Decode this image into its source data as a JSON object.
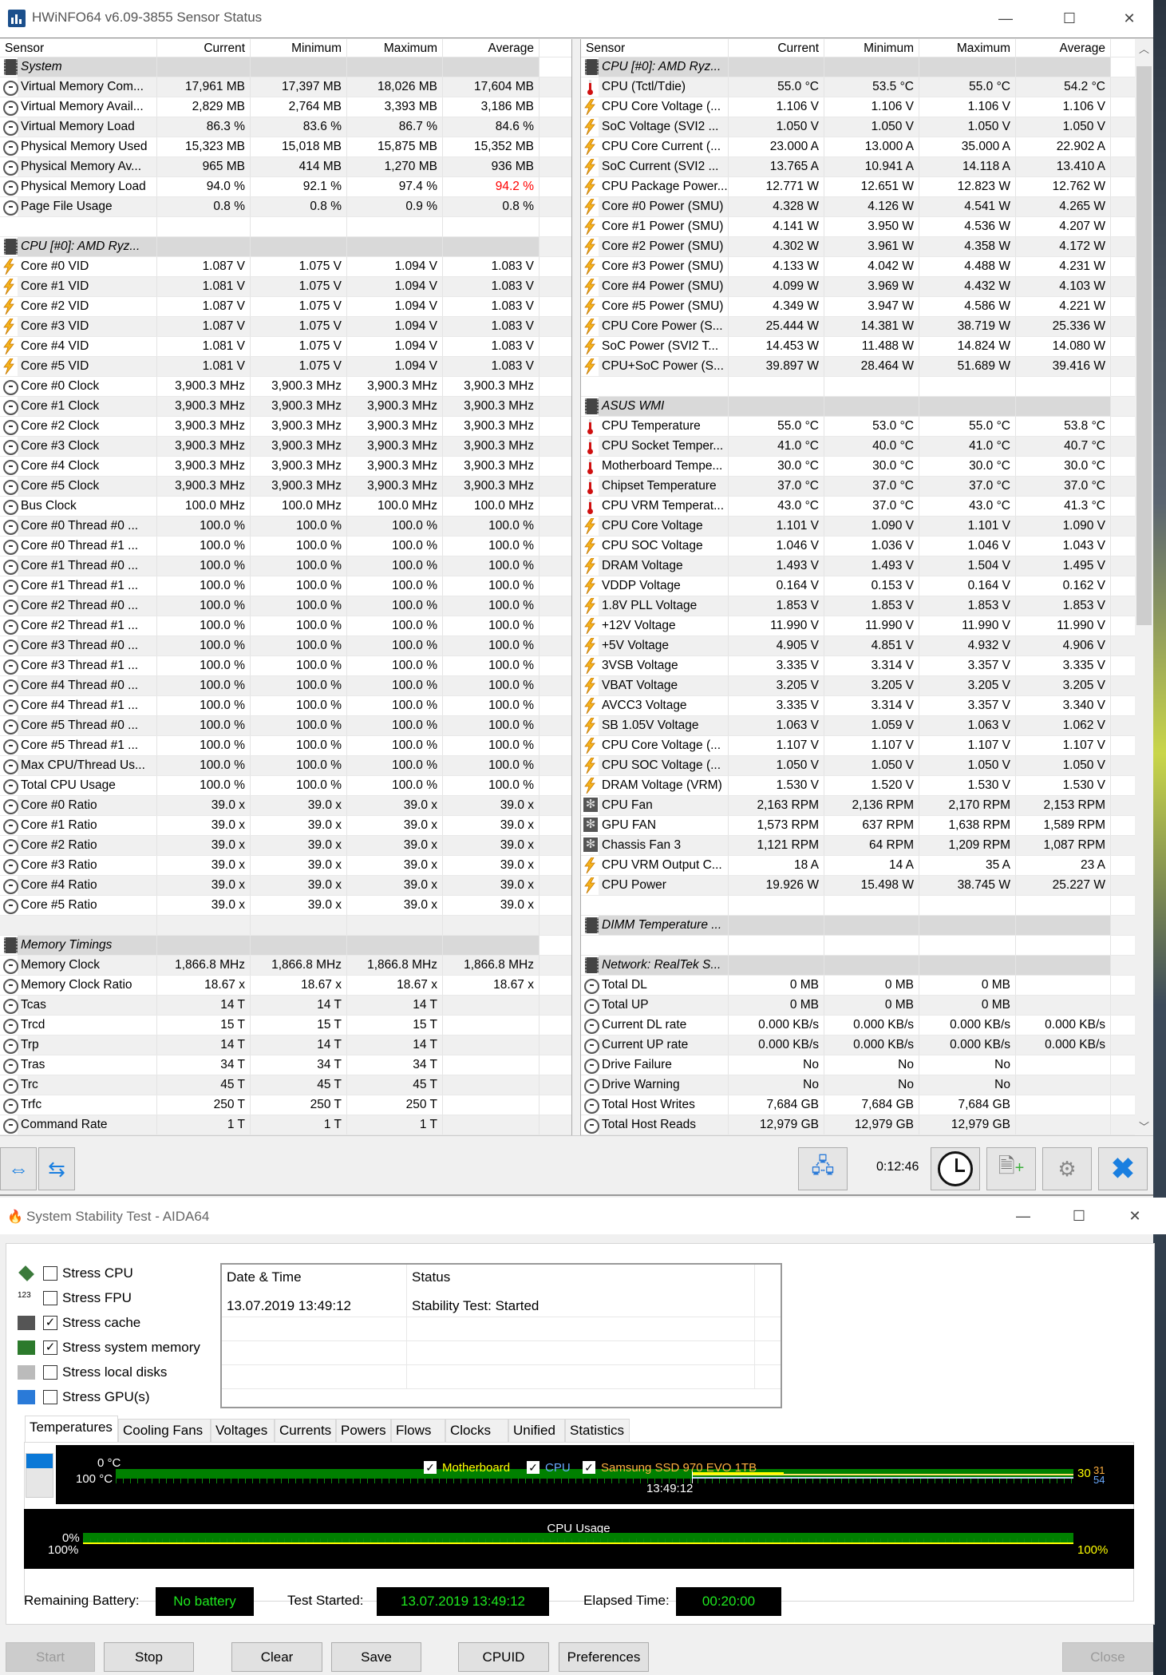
{
  "hwinfo": {
    "title": "HWiNFO64 v6.09-3855 Sensor Status",
    "columns": [
      "Sensor",
      "Current",
      "Minimum",
      "Maximum",
      "Average"
    ],
    "elapsed": "0:12:46",
    "highlight": {
      "panel": "left",
      "row": 6,
      "col": 4,
      "color": "#ff0000"
    },
    "left_rows": [
      [
        "chip",
        "System"
      ],
      [
        "clock",
        "Virtual Memory Com...",
        "17,961 MB",
        "17,397 MB",
        "18,026 MB",
        "17,604 MB"
      ],
      [
        "clock",
        "Virtual Memory Avail...",
        "2,829 MB",
        "2,764 MB",
        "3,393 MB",
        "3,186 MB"
      ],
      [
        "clock",
        "Virtual Memory Load",
        "86.3 %",
        "83.6 %",
        "86.7 %",
        "84.6 %"
      ],
      [
        "clock",
        "Physical Memory Used",
        "15,323 MB",
        "15,018 MB",
        "15,875 MB",
        "15,352 MB"
      ],
      [
        "clock",
        "Physical Memory Av...",
        "965 MB",
        "414 MB",
        "1,270 MB",
        "936 MB"
      ],
      [
        "clock",
        "Physical Memory Load",
        "94.0 %",
        "92.1 %",
        "97.4 %",
        "94.2 %"
      ],
      [
        "clock",
        "Page File Usage",
        "0.8 %",
        "0.8 %",
        "0.9 %",
        "0.8 %"
      ],
      [
        "blank"
      ],
      [
        "chip",
        "CPU [#0]: AMD Ryz..."
      ],
      [
        "bolt",
        "Core #0 VID",
        "1.087 V",
        "1.075 V",
        "1.094 V",
        "1.083 V"
      ],
      [
        "bolt",
        "Core #1 VID",
        "1.081 V",
        "1.075 V",
        "1.094 V",
        "1.083 V"
      ],
      [
        "bolt",
        "Core #2 VID",
        "1.087 V",
        "1.075 V",
        "1.094 V",
        "1.083 V"
      ],
      [
        "bolt",
        "Core #3 VID",
        "1.087 V",
        "1.075 V",
        "1.094 V",
        "1.083 V"
      ],
      [
        "bolt",
        "Core #4 VID",
        "1.081 V",
        "1.075 V",
        "1.094 V",
        "1.083 V"
      ],
      [
        "bolt",
        "Core #5 VID",
        "1.081 V",
        "1.075 V",
        "1.094 V",
        "1.083 V"
      ],
      [
        "clock",
        "Core #0 Clock",
        "3,900.3 MHz",
        "3,900.3 MHz",
        "3,900.3 MHz",
        "3,900.3 MHz"
      ],
      [
        "clock",
        "Core #1 Clock",
        "3,900.3 MHz",
        "3,900.3 MHz",
        "3,900.3 MHz",
        "3,900.3 MHz"
      ],
      [
        "clock",
        "Core #2 Clock",
        "3,900.3 MHz",
        "3,900.3 MHz",
        "3,900.3 MHz",
        "3,900.3 MHz"
      ],
      [
        "clock",
        "Core #3 Clock",
        "3,900.3 MHz",
        "3,900.3 MHz",
        "3,900.3 MHz",
        "3,900.3 MHz"
      ],
      [
        "clock",
        "Core #4 Clock",
        "3,900.3 MHz",
        "3,900.3 MHz",
        "3,900.3 MHz",
        "3,900.3 MHz"
      ],
      [
        "clock",
        "Core #5 Clock",
        "3,900.3 MHz",
        "3,900.3 MHz",
        "3,900.3 MHz",
        "3,900.3 MHz"
      ],
      [
        "clock",
        "Bus Clock",
        "100.0 MHz",
        "100.0 MHz",
        "100.0 MHz",
        "100.0 MHz"
      ],
      [
        "clock",
        "Core #0 Thread #0 ...",
        "100.0 %",
        "100.0 %",
        "100.0 %",
        "100.0 %"
      ],
      [
        "clock",
        "Core #0 Thread #1 ...",
        "100.0 %",
        "100.0 %",
        "100.0 %",
        "100.0 %"
      ],
      [
        "clock",
        "Core #1 Thread #0 ...",
        "100.0 %",
        "100.0 %",
        "100.0 %",
        "100.0 %"
      ],
      [
        "clock",
        "Core #1 Thread #1 ...",
        "100.0 %",
        "100.0 %",
        "100.0 %",
        "100.0 %"
      ],
      [
        "clock",
        "Core #2 Thread #0 ...",
        "100.0 %",
        "100.0 %",
        "100.0 %",
        "100.0 %"
      ],
      [
        "clock",
        "Core #2 Thread #1 ...",
        "100.0 %",
        "100.0 %",
        "100.0 %",
        "100.0 %"
      ],
      [
        "clock",
        "Core #3 Thread #0 ...",
        "100.0 %",
        "100.0 %",
        "100.0 %",
        "100.0 %"
      ],
      [
        "clock",
        "Core #3 Thread #1 ...",
        "100.0 %",
        "100.0 %",
        "100.0 %",
        "100.0 %"
      ],
      [
        "clock",
        "Core #4 Thread #0 ...",
        "100.0 %",
        "100.0 %",
        "100.0 %",
        "100.0 %"
      ],
      [
        "clock",
        "Core #4 Thread #1 ...",
        "100.0 %",
        "100.0 %",
        "100.0 %",
        "100.0 %"
      ],
      [
        "clock",
        "Core #5 Thread #0 ...",
        "100.0 %",
        "100.0 %",
        "100.0 %",
        "100.0 %"
      ],
      [
        "clock",
        "Core #5 Thread #1 ...",
        "100.0 %",
        "100.0 %",
        "100.0 %",
        "100.0 %"
      ],
      [
        "clock",
        "Max CPU/Thread Us...",
        "100.0 %",
        "100.0 %",
        "100.0 %",
        "100.0 %"
      ],
      [
        "clock",
        "Total CPU Usage",
        "100.0 %",
        "100.0 %",
        "100.0 %",
        "100.0 %"
      ],
      [
        "clock",
        "Core #0 Ratio",
        "39.0 x",
        "39.0 x",
        "39.0 x",
        "39.0 x"
      ],
      [
        "clock",
        "Core #1 Ratio",
        "39.0 x",
        "39.0 x",
        "39.0 x",
        "39.0 x"
      ],
      [
        "clock",
        "Core #2 Ratio",
        "39.0 x",
        "39.0 x",
        "39.0 x",
        "39.0 x"
      ],
      [
        "clock",
        "Core #3 Ratio",
        "39.0 x",
        "39.0 x",
        "39.0 x",
        "39.0 x"
      ],
      [
        "clock",
        "Core #4 Ratio",
        "39.0 x",
        "39.0 x",
        "39.0 x",
        "39.0 x"
      ],
      [
        "clock",
        "Core #5 Ratio",
        "39.0 x",
        "39.0 x",
        "39.0 x",
        "39.0 x"
      ],
      [
        "blank"
      ],
      [
        "chip",
        "Memory Timings"
      ],
      [
        "clock",
        "Memory Clock",
        "1,866.8 MHz",
        "1,866.8 MHz",
        "1,866.8 MHz",
        "1,866.8 MHz"
      ],
      [
        "clock",
        "Memory Clock Ratio",
        "18.67 x",
        "18.67 x",
        "18.67 x",
        "18.67 x"
      ],
      [
        "clock",
        "Tcas",
        "14 T",
        "14 T",
        "14 T",
        ""
      ],
      [
        "clock",
        "Trcd",
        "15 T",
        "15 T",
        "15 T",
        ""
      ],
      [
        "clock",
        "Trp",
        "14 T",
        "14 T",
        "14 T",
        ""
      ],
      [
        "clock",
        "Tras",
        "34 T",
        "34 T",
        "34 T",
        ""
      ],
      [
        "clock",
        "Trc",
        "45 T",
        "45 T",
        "45 T",
        ""
      ],
      [
        "clock",
        "Trfc",
        "250 T",
        "250 T",
        "250 T",
        ""
      ],
      [
        "clock",
        "Command Rate",
        "1 T",
        "1 T",
        "1 T",
        ""
      ]
    ],
    "right_rows": [
      [
        "chip",
        "CPU [#0]: AMD Ryz..."
      ],
      [
        "therm",
        "CPU (Tctl/Tdie)",
        "55.0 °C",
        "53.5 °C",
        "55.0 °C",
        "54.2 °C"
      ],
      [
        "bolt",
        "CPU Core Voltage (...",
        "1.106 V",
        "1.106 V",
        "1.106 V",
        "1.106 V"
      ],
      [
        "bolt",
        "SoC Voltage (SVI2 ...",
        "1.050 V",
        "1.050 V",
        "1.050 V",
        "1.050 V"
      ],
      [
        "bolt",
        "CPU Core Current (...",
        "23.000 A",
        "13.000 A",
        "35.000 A",
        "22.902 A"
      ],
      [
        "bolt",
        "SoC Current (SVI2 ...",
        "13.765 A",
        "10.941 A",
        "14.118 A",
        "13.410 A"
      ],
      [
        "bolt",
        "CPU Package Power...",
        "12.771 W",
        "12.651 W",
        "12.823 W",
        "12.762 W"
      ],
      [
        "bolt",
        "Core #0 Power (SMU)",
        "4.328 W",
        "4.126 W",
        "4.541 W",
        "4.265 W"
      ],
      [
        "bolt",
        "Core #1 Power (SMU)",
        "4.141 W",
        "3.950 W",
        "4.536 W",
        "4.207 W"
      ],
      [
        "bolt",
        "Core #2 Power (SMU)",
        "4.302 W",
        "3.961 W",
        "4.358 W",
        "4.172 W"
      ],
      [
        "bolt",
        "Core #3 Power (SMU)",
        "4.133 W",
        "4.042 W",
        "4.488 W",
        "4.231 W"
      ],
      [
        "bolt",
        "Core #4 Power (SMU)",
        "4.099 W",
        "3.969 W",
        "4.432 W",
        "4.103 W"
      ],
      [
        "bolt",
        "Core #5 Power (SMU)",
        "4.349 W",
        "3.947 W",
        "4.586 W",
        "4.221 W"
      ],
      [
        "bolt",
        "CPU Core Power (S...",
        "25.444 W",
        "14.381 W",
        "38.719 W",
        "25.336 W"
      ],
      [
        "bolt",
        "SoC Power (SVI2 T...",
        "14.453 W",
        "11.488 W",
        "14.824 W",
        "14.080 W"
      ],
      [
        "bolt",
        "CPU+SoC Power (S...",
        "39.897 W",
        "28.464 W",
        "51.689 W",
        "39.416 W"
      ],
      [
        "blank"
      ],
      [
        "chip",
        "ASUS WMI"
      ],
      [
        "therm",
        "CPU Temperature",
        "55.0 °C",
        "53.0 °C",
        "55.0 °C",
        "53.8 °C"
      ],
      [
        "therm",
        "CPU Socket Temper...",
        "41.0 °C",
        "40.0 °C",
        "41.0 °C",
        "40.7 °C"
      ],
      [
        "therm",
        "Motherboard Tempe...",
        "30.0 °C",
        "30.0 °C",
        "30.0 °C",
        "30.0 °C"
      ],
      [
        "therm",
        "Chipset Temperature",
        "37.0 °C",
        "37.0 °C",
        "37.0 °C",
        "37.0 °C"
      ],
      [
        "therm",
        "CPU VRM Temperat...",
        "43.0 °C",
        "37.0 °C",
        "43.0 °C",
        "41.3 °C"
      ],
      [
        "bolt",
        "CPU Core Voltage",
        "1.101 V",
        "1.090 V",
        "1.101 V",
        "1.090 V"
      ],
      [
        "bolt",
        "CPU SOC Voltage",
        "1.046 V",
        "1.036 V",
        "1.046 V",
        "1.043 V"
      ],
      [
        "bolt",
        "DRAM Voltage",
        "1.493 V",
        "1.493 V",
        "1.504 V",
        "1.495 V"
      ],
      [
        "bolt",
        "VDDP Voltage",
        "0.164 V",
        "0.153 V",
        "0.164 V",
        "0.162 V"
      ],
      [
        "bolt",
        "1.8V PLL Voltage",
        "1.853 V",
        "1.853 V",
        "1.853 V",
        "1.853 V"
      ],
      [
        "bolt",
        "+12V Voltage",
        "11.990 V",
        "11.990 V",
        "11.990 V",
        "11.990 V"
      ],
      [
        "bolt",
        "+5V Voltage",
        "4.905 V",
        "4.851 V",
        "4.932 V",
        "4.906 V"
      ],
      [
        "bolt",
        "3VSB Voltage",
        "3.335 V",
        "3.314 V",
        "3.357 V",
        "3.335 V"
      ],
      [
        "bolt",
        "VBAT Voltage",
        "3.205 V",
        "3.205 V",
        "3.205 V",
        "3.205 V"
      ],
      [
        "bolt",
        "AVCC3 Voltage",
        "3.335 V",
        "3.314 V",
        "3.357 V",
        "3.340 V"
      ],
      [
        "bolt",
        "SB 1.05V Voltage",
        "1.063 V",
        "1.059 V",
        "1.063 V",
        "1.062 V"
      ],
      [
        "bolt",
        "CPU Core Voltage (...",
        "1.107 V",
        "1.107 V",
        "1.107 V",
        "1.107 V"
      ],
      [
        "bolt",
        "CPU SOC Voltage (...",
        "1.050 V",
        "1.050 V",
        "1.050 V",
        "1.050 V"
      ],
      [
        "bolt",
        "DRAM Voltage (VRM)",
        "1.530 V",
        "1.520 V",
        "1.530 V",
        "1.530 V"
      ],
      [
        "fan",
        "CPU Fan",
        "2,163 RPM",
        "2,136 RPM",
        "2,170 RPM",
        "2,153 RPM"
      ],
      [
        "fan",
        "GPU FAN",
        "1,573 RPM",
        "637 RPM",
        "1,638 RPM",
        "1,589 RPM"
      ],
      [
        "fan",
        "Chassis Fan 3",
        "1,121 RPM",
        "64 RPM",
        "1,209 RPM",
        "1,087 RPM"
      ],
      [
        "bolt",
        "CPU VRM Output C...",
        "18 A",
        "14 A",
        "35 A",
        "23 A"
      ],
      [
        "bolt",
        "CPU Power",
        "19.926 W",
        "15.498 W",
        "38.745 W",
        "25.227 W"
      ],
      [
        "blank"
      ],
      [
        "chip",
        "DIMM Temperature ..."
      ],
      [
        "blank"
      ],
      [
        "chip",
        "Network: RealTek S..."
      ],
      [
        "clock",
        "Total DL",
        "0 MB",
        "0 MB",
        "0 MB",
        ""
      ],
      [
        "clock",
        "Total UP",
        "0 MB",
        "0 MB",
        "0 MB",
        ""
      ],
      [
        "clock",
        "Current DL rate",
        "0.000 KB/s",
        "0.000 KB/s",
        "0.000 KB/s",
        "0.000 KB/s"
      ],
      [
        "clock",
        "Current UP rate",
        "0.000 KB/s",
        "0.000 KB/s",
        "0.000 KB/s",
        "0.000 KB/s"
      ],
      [
        "clock",
        "Drive Failure",
        "No",
        "No",
        "No",
        ""
      ],
      [
        "clock",
        "Drive Warning",
        "No",
        "No",
        "No",
        ""
      ],
      [
        "clock",
        "Total Host Writes",
        "7,684 GB",
        "7,684 GB",
        "7,684 GB",
        ""
      ],
      [
        "clock",
        "Total Host Reads",
        "12,979 GB",
        "12,979 GB",
        "12,979 GB",
        ""
      ]
    ]
  },
  "aida": {
    "title": "System Stability Test - AIDA64",
    "stress_options": [
      {
        "label": "Stress CPU",
        "checked": false
      },
      {
        "label": "Stress FPU",
        "checked": false
      },
      {
        "label": "Stress cache",
        "checked": true
      },
      {
        "label": "Stress system memory",
        "checked": true
      },
      {
        "label": "Stress local disks",
        "checked": false
      },
      {
        "label": "Stress GPU(s)",
        "checked": false
      }
    ],
    "fpu_icon_text": "123",
    "check_mark": "✓",
    "log": {
      "headers": [
        "Date & Time",
        "Status"
      ],
      "rows": [
        [
          "13.07.2019 13:49:12",
          "Stability Test: Started"
        ]
      ]
    },
    "tabs": [
      "Temperatures",
      "Cooling Fans",
      "Voltages",
      "Currents",
      "Powers",
      "Flows",
      "Clocks",
      "Unified",
      "Statistics"
    ],
    "active_tab": 0,
    "temp_graph": {
      "legend": [
        {
          "label": "Motherboard",
          "color": "#ffff00"
        },
        {
          "label": "CPU",
          "color": "#6aaaff"
        },
        {
          "label": "Samsung SSD 970 EVO 1TB",
          "color": "#ffb040"
        }
      ],
      "y_top": "0 °C",
      "y_bottom": "100 °C",
      "time_label": "13:49:12",
      "current_values": [
        "30",
        "31",
        "54"
      ]
    },
    "cpu_graph": {
      "title": "CPU Usage",
      "y_top": "0%",
      "y_bottom": "100%",
      "current_value": "100%"
    },
    "status": {
      "battery_label": "Remaining Battery:",
      "battery_value": "No battery",
      "started_label": "Test Started:",
      "started_value": "13.07.2019 13:49:12",
      "elapsed_label": "Elapsed Time:",
      "elapsed_value": "00:20:00"
    },
    "buttons": {
      "start": "Start",
      "stop": "Stop",
      "clear": "Clear",
      "save": "Save",
      "cpuid": "CPUID",
      "preferences": "Preferences",
      "close": "Close"
    }
  }
}
